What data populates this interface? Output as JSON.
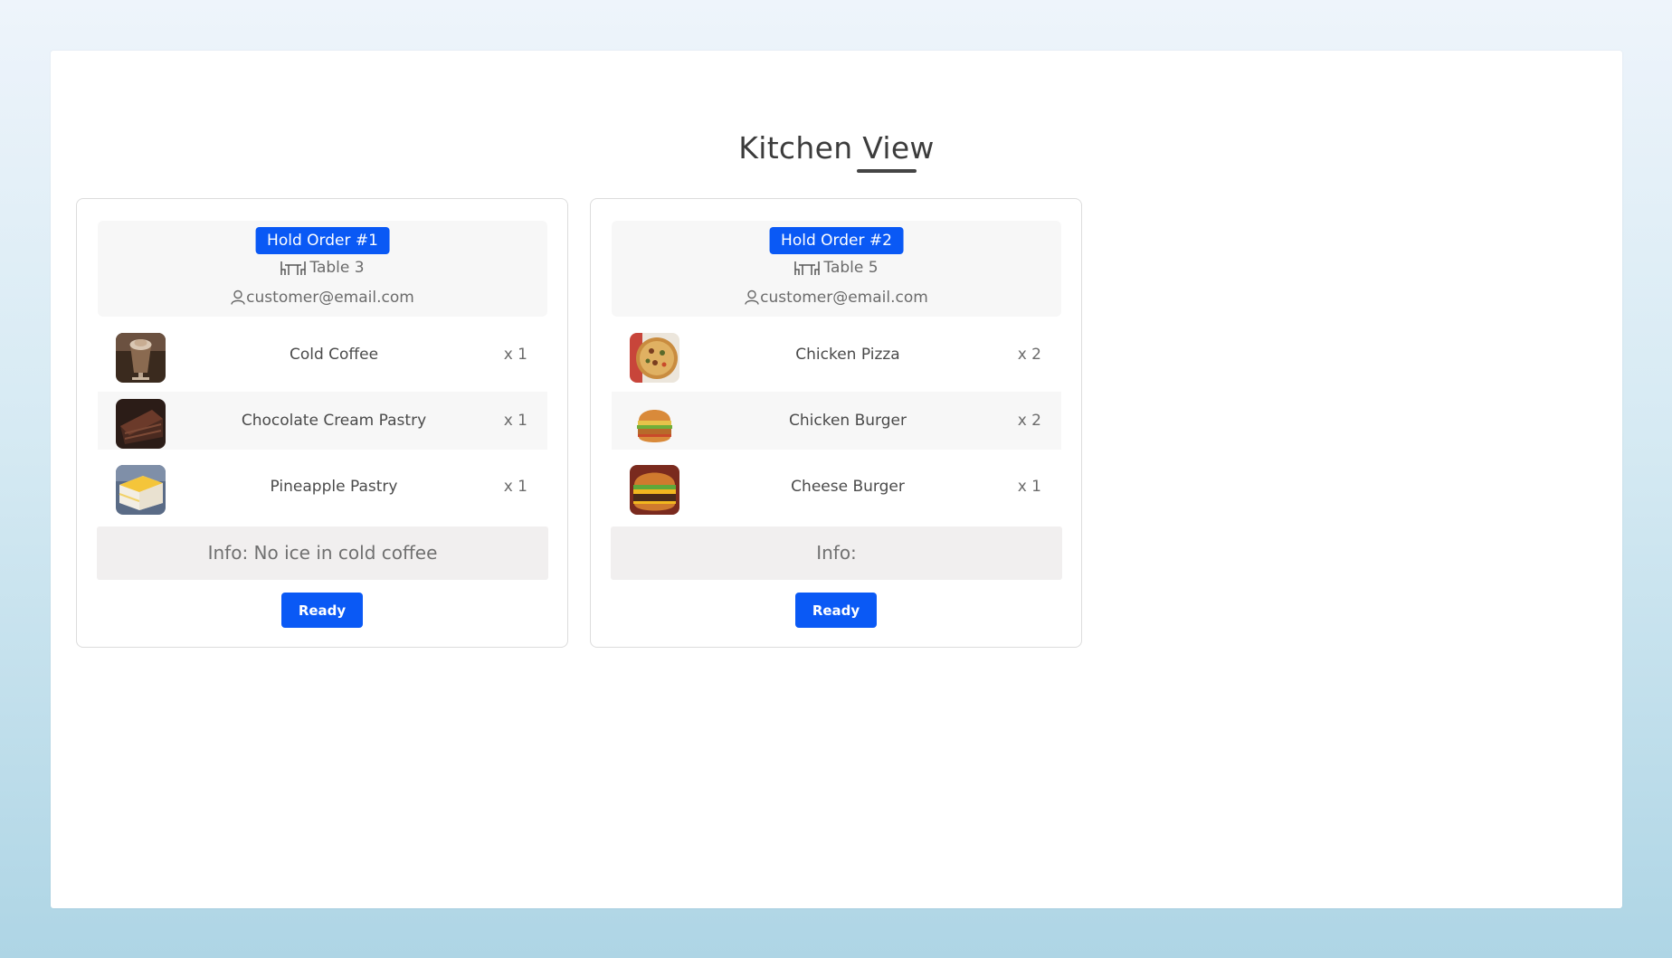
{
  "page": {
    "title": "Kitchen View"
  },
  "colors": {
    "accent": "#0a59f5",
    "header_bg": "#f7f7f7",
    "info_bg": "#f1efef"
  },
  "orders": [
    {
      "badge": "Hold Order #1",
      "table": "Table 3",
      "customer": "customer@email.com",
      "items": [
        {
          "name": "Cold Coffee",
          "qty": "x 1",
          "icon": "cold-coffee-image"
        },
        {
          "name": "Chocolate Cream Pastry",
          "qty": "x 1",
          "icon": "chocolate-pastry-image"
        },
        {
          "name": "Pineapple Pastry",
          "qty": "x 1",
          "icon": "pineapple-pastry-image"
        }
      ],
      "info": "Info: No ice in cold coffee",
      "button": "Ready"
    },
    {
      "badge": "Hold Order #2",
      "table": "Table 5",
      "customer": "customer@email.com",
      "items": [
        {
          "name": "Chicken Pizza",
          "qty": "x 2",
          "icon": "pizza-image"
        },
        {
          "name": "Chicken Burger",
          "qty": "x 2",
          "icon": "chicken-burger-image"
        },
        {
          "name": "Cheese Burger",
          "qty": "x 1",
          "icon": "cheese-burger-image"
        }
      ],
      "info": "Info:",
      "button": "Ready"
    }
  ]
}
